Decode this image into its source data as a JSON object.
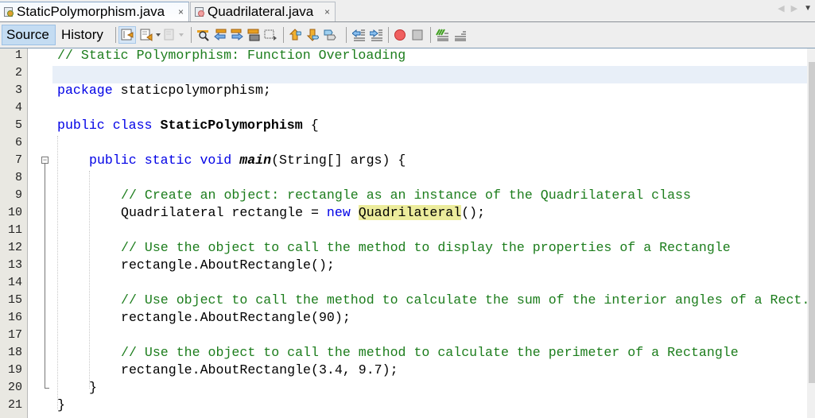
{
  "tabs": [
    {
      "label": "StaticPolymorphism.java",
      "active": true,
      "icon": "java-main-file-icon"
    },
    {
      "label": "Quadrilateral.java",
      "active": false,
      "icon": "java-class-file-icon"
    }
  ],
  "tab_close_glyph": "×",
  "tab_nav": {
    "left": "◀",
    "right": "▶",
    "dropdown": "▼"
  },
  "toolbar": {
    "source_label": "Source",
    "history_label": "History",
    "icons": [
      "last-edit-icon",
      "back-icon",
      "forward-icon",
      "find-selection-icon",
      "find-previous-icon",
      "find-next-icon",
      "toggle-highlight-icon",
      "toggle-rect-selection-icon",
      "previous-bookmark-icon",
      "next-bookmark-icon",
      "toggle-bookmark-icon",
      "shift-left-icon",
      "shift-right-icon",
      "start-macro-icon",
      "stop-macro-icon",
      "comment-icon",
      "uncomment-icon"
    ]
  },
  "editor": {
    "current_line": 2,
    "line_numbers": [
      "1",
      "2",
      "3",
      "4",
      "5",
      "6",
      "7",
      "8",
      "9",
      "10",
      "11",
      "12",
      "13",
      "14",
      "15",
      "16",
      "17",
      "18",
      "19",
      "20",
      "21"
    ],
    "lines": [
      {
        "n": 1,
        "indent": 0,
        "tokens": [
          {
            "t": "// Static Polymorphism: Function Overloading",
            "c": "cmt"
          }
        ]
      },
      {
        "n": 2,
        "indent": 0,
        "tokens": []
      },
      {
        "n": 3,
        "indent": 0,
        "tokens": [
          {
            "t": "package",
            "c": "kw"
          },
          {
            "t": " staticpolymorphism;",
            "c": ""
          }
        ]
      },
      {
        "n": 4,
        "indent": 0,
        "tokens": []
      },
      {
        "n": 5,
        "indent": 0,
        "tokens": [
          {
            "t": "public",
            "c": "kw"
          },
          {
            "t": " ",
            "c": ""
          },
          {
            "t": "class",
            "c": "kw"
          },
          {
            "t": " ",
            "c": ""
          },
          {
            "t": "StaticPolymorphism",
            "c": "bold"
          },
          {
            "t": " {",
            "c": ""
          }
        ]
      },
      {
        "n": 6,
        "indent": 0,
        "tokens": []
      },
      {
        "n": 7,
        "indent": 1,
        "tokens": [
          {
            "t": "public",
            "c": "kw"
          },
          {
            "t": " ",
            "c": ""
          },
          {
            "t": "static",
            "c": "kw"
          },
          {
            "t": " ",
            "c": ""
          },
          {
            "t": "void",
            "c": "kw"
          },
          {
            "t": " ",
            "c": ""
          },
          {
            "t": "main",
            "c": "bi"
          },
          {
            "t": "(String[] args) {",
            "c": ""
          }
        ]
      },
      {
        "n": 8,
        "indent": 0,
        "tokens": []
      },
      {
        "n": 9,
        "indent": 2,
        "tokens": [
          {
            "t": "// Create an object: rectangle as an instance of the Quadrilateral class",
            "c": "cmt"
          }
        ]
      },
      {
        "n": 10,
        "indent": 2,
        "tokens": [
          {
            "t": "Quadrilateral rectangle = ",
            "c": ""
          },
          {
            "t": "new",
            "c": "kw"
          },
          {
            "t": " ",
            "c": ""
          },
          {
            "t": "Quadrilateral",
            "c": "hl"
          },
          {
            "t": "();",
            "c": ""
          }
        ]
      },
      {
        "n": 11,
        "indent": 0,
        "tokens": []
      },
      {
        "n": 12,
        "indent": 2,
        "tokens": [
          {
            "t": "// Use the object to call the method to display the properties of a Rectangle",
            "c": "cmt"
          }
        ]
      },
      {
        "n": 13,
        "indent": 2,
        "tokens": [
          {
            "t": "rectangle.AboutRectangle();",
            "c": ""
          }
        ]
      },
      {
        "n": 14,
        "indent": 0,
        "tokens": []
      },
      {
        "n": 15,
        "indent": 2,
        "tokens": [
          {
            "t": "// Use object to call the method to calculate the sum of the interior angles of a Rect.",
            "c": "cmt"
          }
        ]
      },
      {
        "n": 16,
        "indent": 2,
        "tokens": [
          {
            "t": "rectangle.AboutRectangle(90);",
            "c": ""
          }
        ]
      },
      {
        "n": 17,
        "indent": 0,
        "tokens": []
      },
      {
        "n": 18,
        "indent": 2,
        "tokens": [
          {
            "t": "// Use the object to call the method to calculate the perimeter of a Rectangle",
            "c": "cmt"
          }
        ]
      },
      {
        "n": 19,
        "indent": 2,
        "tokens": [
          {
            "t": "rectangle.AboutRectangle(3.4, 9.7);",
            "c": ""
          }
        ]
      },
      {
        "n": 20,
        "indent": 1,
        "tokens": [
          {
            "t": "}",
            "c": ""
          }
        ]
      },
      {
        "n": 21,
        "indent": 0,
        "tokens": [
          {
            "t": "}",
            "c": ""
          }
        ]
      }
    ]
  },
  "colors": {
    "comment": "#1c7d1c",
    "keyword": "#0000e6",
    "highlight": "#ecec9c",
    "current_line": "#e8eff8",
    "gutter": "#e9e8e2",
    "source_tab_active": "#c4dcf2"
  }
}
